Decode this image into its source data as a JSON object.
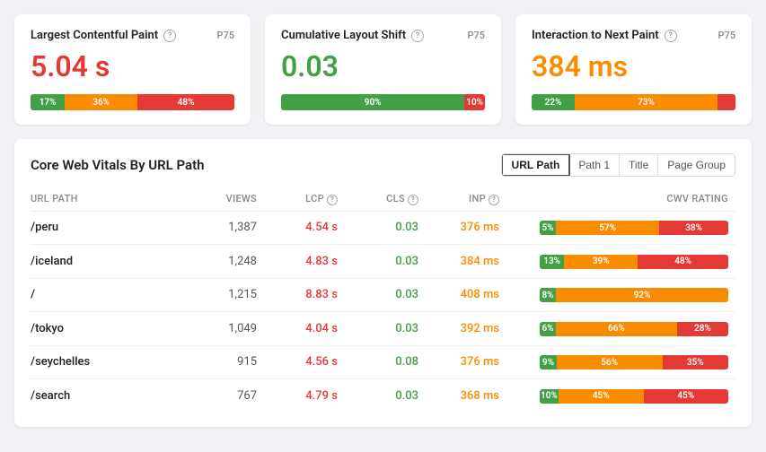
{
  "metrics": [
    {
      "id": "lcp",
      "title": "Largest Contentful Paint",
      "badge": "P75",
      "value": "5.04 s",
      "value_color": "red",
      "segments": [
        {
          "label": "17%",
          "value": 17,
          "class": "seg-green"
        },
        {
          "label": "36%",
          "value": 36,
          "class": "seg-orange"
        },
        {
          "label": "48%",
          "value": 48,
          "class": "seg-red"
        }
      ]
    },
    {
      "id": "cls",
      "title": "Cumulative Layout Shift",
      "badge": "P75",
      "value": "0.03",
      "value_color": "green",
      "segments": [
        {
          "label": "90%",
          "value": 90,
          "class": "seg-green"
        },
        {
          "label": "10%",
          "value": 10,
          "class": "seg-red"
        }
      ]
    },
    {
      "id": "inp",
      "title": "Interaction to Next Paint",
      "badge": "P75",
      "value": "384 ms",
      "value_color": "orange",
      "segments": [
        {
          "label": "22%",
          "value": 22,
          "class": "seg-green"
        },
        {
          "label": "73%",
          "value": 73,
          "class": "seg-orange"
        },
        {
          "label": "",
          "value": 5,
          "class": "seg-red"
        }
      ]
    }
  ],
  "table": {
    "title": "Core Web Vitals By URL Path",
    "tabs": [
      "URL Path",
      "Path 1",
      "Title",
      "Page Group"
    ],
    "active_tab": 0,
    "columns": {
      "path": "URL PATH",
      "views": "VIEWS",
      "lcp": "LCP",
      "cls": "CLS",
      "inp": "INP",
      "rating": "CWV RATING"
    },
    "rows": [
      {
        "path": "/peru",
        "views": "1,387",
        "lcp": "4.54 s",
        "cls": "0.03",
        "inp": "376 ms",
        "rating": [
          {
            "label": "5%",
            "value": 5,
            "class": "rb-green"
          },
          {
            "label": "57%",
            "value": 57,
            "class": "rb-orange"
          },
          {
            "label": "38%",
            "value": 38,
            "class": "rb-red"
          }
        ]
      },
      {
        "path": "/iceland",
        "views": "1,248",
        "lcp": "4.83 s",
        "cls": "0.03",
        "inp": "384 ms",
        "rating": [
          {
            "label": "13%",
            "value": 13,
            "class": "rb-green"
          },
          {
            "label": "39%",
            "value": 39,
            "class": "rb-orange"
          },
          {
            "label": "48%",
            "value": 48,
            "class": "rb-red"
          }
        ]
      },
      {
        "path": "/",
        "views": "1,215",
        "lcp": "8.83 s",
        "cls": "0.03",
        "inp": "408 ms",
        "rating": [
          {
            "label": "8%",
            "value": 8,
            "class": "rb-green"
          },
          {
            "label": "92%",
            "value": 92,
            "class": "rb-orange"
          },
          {
            "label": "",
            "value": 0,
            "class": "rb-red"
          }
        ]
      },
      {
        "path": "/tokyo",
        "views": "1,049",
        "lcp": "4.04 s",
        "cls": "0.03",
        "inp": "392 ms",
        "rating": [
          {
            "label": "6%",
            "value": 6,
            "class": "rb-green"
          },
          {
            "label": "66%",
            "value": 66,
            "class": "rb-orange"
          },
          {
            "label": "28%",
            "value": 28,
            "class": "rb-red"
          }
        ]
      },
      {
        "path": "/seychelles",
        "views": "915",
        "lcp": "4.56 s",
        "cls": "0.08",
        "inp": "376 ms",
        "rating": [
          {
            "label": "9%",
            "value": 9,
            "class": "rb-green"
          },
          {
            "label": "56%",
            "value": 56,
            "class": "rb-orange"
          },
          {
            "label": "35%",
            "value": 35,
            "class": "rb-red"
          }
        ]
      },
      {
        "path": "/search",
        "views": "767",
        "lcp": "4.79 s",
        "cls": "0.03",
        "inp": "368 ms",
        "rating": [
          {
            "label": "10%",
            "value": 10,
            "class": "rb-green"
          },
          {
            "label": "45%",
            "value": 45,
            "class": "rb-orange"
          },
          {
            "label": "45%",
            "value": 45,
            "class": "rb-red"
          }
        ]
      }
    ]
  }
}
